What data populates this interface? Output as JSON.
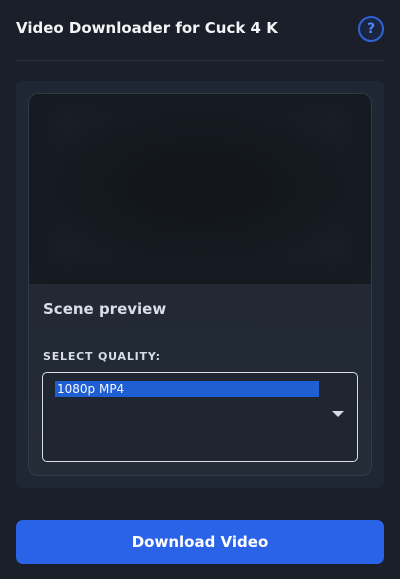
{
  "header": {
    "title": "Video Downloader for Cuck 4 K",
    "help_symbol": "?"
  },
  "preview": {
    "label": "Scene preview"
  },
  "quality": {
    "label": "SELECT QUALITY:",
    "selected": "1080p MP4"
  },
  "actions": {
    "download_label": "Download Video"
  },
  "colors": {
    "background": "#1a1f29",
    "panel": "#202734",
    "accent": "#2b63e8",
    "selection": "#1f5fd3"
  },
  "icons": {
    "help": "question-mark-icon",
    "dropdown": "chevron-down-icon"
  }
}
